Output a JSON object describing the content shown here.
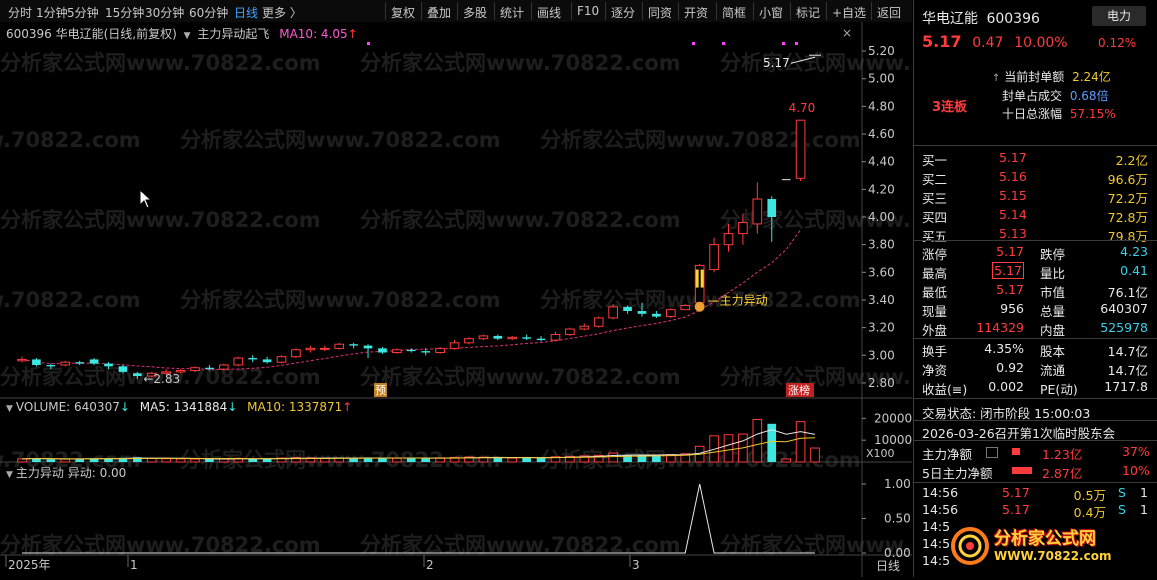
{
  "toolbar": {
    "periods": [
      "分时",
      "1分钟",
      "5分钟",
      "15分钟",
      "30分钟",
      "60分钟",
      "日线",
      "更多 〉"
    ],
    "active_period": "日线",
    "tools": [
      "复权",
      "叠加",
      "多股",
      "统计",
      "画线",
      "F10",
      "逐分",
      "同资",
      "开资",
      "简框",
      "小窗",
      "标记",
      "+自选",
      "返回"
    ]
  },
  "chart": {
    "header_code_name": "600396 华电辽能(日线,前复权)",
    "indicator_name": "主力异动起飞",
    "ma10_label": "MA10: 4.05",
    "ma10_arrow": "↑",
    "watermark": "分析家公式网www.70822.com",
    "y_ticks": [
      "5.20",
      "5.00",
      "4.80",
      "4.60",
      "4.40",
      "4.20",
      "4.00",
      "3.80",
      "3.60",
      "3.40",
      "3.20",
      "3.00",
      "2.80"
    ],
    "high_label": "4.70",
    "low_label": "←2.83",
    "last_label": "5.17",
    "signal_label": "主力异动",
    "tag_pre": "预",
    "tag_zhangbang": "涨榜"
  },
  "volume": {
    "label": "VOLUME: 640307",
    "vol_arrow": "↓",
    "ma5": "MA5: 1341884",
    "ma5_arrow": "↓",
    "ma10": "MA10: 1337871",
    "ma10_arrow": "↑",
    "y_ticks": [
      "20000",
      "10000"
    ],
    "unit": "X100"
  },
  "anomaly": {
    "label": "主力异动  异动: 0.00",
    "y_ticks": [
      "1.00",
      "0.50",
      "0.00"
    ]
  },
  "x_axis": {
    "labels": [
      "2025年",
      "1",
      "2",
      "3"
    ],
    "period": "日线"
  },
  "panel": {
    "stock_name": "华电辽能",
    "stock_code": "600396",
    "sector": "电力",
    "price": "5.17",
    "change": "0.47",
    "change_pct": "10.00%",
    "sector_pct": "0.12%",
    "streak": "3连板",
    "seal_amount_label": "当前封单额",
    "seal_amount": "2.24亿",
    "seal_ratio_label": "封单占成交",
    "seal_ratio": "0.68倍",
    "ten_day_label": "十日总涨幅",
    "ten_day": "57.15%",
    "bids": [
      {
        "label": "买一",
        "price": "5.17",
        "vol": "2.2亿"
      },
      {
        "label": "买二",
        "price": "5.16",
        "vol": "96.6万"
      },
      {
        "label": "买三",
        "price": "5.15",
        "vol": "72.2万"
      },
      {
        "label": "买四",
        "price": "5.14",
        "vol": "72.8万"
      },
      {
        "label": "买五",
        "price": "5.13",
        "vol": "79.8万"
      }
    ],
    "stats": [
      {
        "l1": "涨停",
        "v1": "5.17",
        "l2": "跌停",
        "v2": "4.23"
      },
      {
        "l1": "最高",
        "v1": "5.17",
        "l2": "量比",
        "v2": "0.41"
      },
      {
        "l1": "最低",
        "v1": "5.17",
        "l2": "市值",
        "v2": "76.1亿"
      },
      {
        "l1": "现量",
        "v1": "956",
        "l2": "总量",
        "v2": "640307"
      },
      {
        "l1": "外盘",
        "v1": "114329",
        "l2": "内盘",
        "v2": "525978"
      }
    ],
    "fin": [
      {
        "l1": "换手",
        "v1": "4.35%",
        "l2": "股本",
        "v2": "14.7亿"
      },
      {
        "l1": "净资",
        "v1": "0.92",
        "l2": "流通",
        "v2": "14.7亿"
      },
      {
        "l1": "收益(≡)",
        "v1": "0.002",
        "l2": "PE(动)",
        "v2": "1717.8"
      }
    ],
    "trade_status": "交易状态: 闭市阶段 15:00:03",
    "notice": "2026-03-26召开第1次临时股东会",
    "flow1_label": "主力净额",
    "flow1_value": "1.23亿",
    "flow1_pct": "37%",
    "flow2_label": "5日主力净额",
    "flow2_value": "2.87亿",
    "flow2_pct": "10%",
    "ticks": [
      {
        "time": "14:56",
        "price": "5.17",
        "vol": "0.5万",
        "side": "S",
        "n": "1"
      },
      {
        "time": "14:56",
        "price": "5.17",
        "vol": "0.4万",
        "side": "S",
        "n": "1"
      },
      {
        "time": "14:5",
        "price": "",
        "vol": "",
        "side": "",
        "n": ""
      },
      {
        "time": "14:5",
        "price": "",
        "vol": "",
        "side": "",
        "n": ""
      },
      {
        "time": "14:5",
        "price": "",
        "vol": "",
        "side": "",
        "n": ""
      }
    ],
    "logo_text": "分析家公式网",
    "logo_url": "WWW.70822.com"
  },
  "colors": {
    "up": "#ff3b3b",
    "down": "#3ee6e0",
    "ma": "#e8e8e8",
    "ma10": "#f0c830"
  },
  "chart_data": {
    "type": "candlestick",
    "ylim": [
      2.72,
      5.28
    ],
    "candles": [
      [
        2.96,
        2.97,
        2.95,
        2.99
      ],
      [
        2.97,
        2.93,
        2.92,
        2.98
      ],
      [
        2.93,
        2.92,
        2.9,
        2.94
      ],
      [
        2.93,
        2.95,
        2.92,
        2.96
      ],
      [
        2.95,
        2.94,
        2.93,
        2.96
      ],
      [
        2.97,
        2.94,
        2.93,
        2.98
      ],
      [
        2.94,
        2.92,
        2.9,
        2.95
      ],
      [
        2.92,
        2.88,
        2.87,
        2.93
      ],
      [
        2.87,
        2.85,
        2.83,
        2.88
      ],
      [
        2.85,
        2.87,
        2.84,
        2.88
      ],
      [
        2.87,
        2.88,
        2.86,
        2.9
      ],
      [
        2.88,
        2.89,
        2.87,
        2.9
      ],
      [
        2.89,
        2.91,
        2.88,
        2.92
      ],
      [
        2.91,
        2.9,
        2.89,
        2.93
      ],
      [
        2.9,
        2.93,
        2.89,
        2.94
      ],
      [
        2.93,
        2.98,
        2.92,
        2.99
      ],
      [
        2.98,
        2.97,
        2.95,
        3.0
      ],
      [
        2.97,
        2.95,
        2.94,
        2.99
      ],
      [
        2.95,
        2.99,
        2.94,
        3.0
      ],
      [
        2.99,
        3.04,
        2.98,
        3.05
      ],
      [
        3.04,
        3.05,
        3.02,
        3.07
      ],
      [
        3.05,
        3.05,
        3.03,
        3.07
      ],
      [
        3.05,
        3.08,
        3.04,
        3.09
      ],
      [
        3.08,
        3.07,
        3.05,
        3.09
      ],
      [
        3.07,
        3.05,
        2.98,
        3.08
      ],
      [
        3.05,
        3.02,
        3.01,
        3.06
      ],
      [
        3.02,
        3.04,
        3.01,
        3.05
      ],
      [
        3.04,
        3.03,
        3.02,
        3.05
      ],
      [
        3.03,
        3.02,
        3.0,
        3.05
      ],
      [
        3.02,
        3.05,
        3.01,
        3.06
      ],
      [
        3.05,
        3.09,
        3.04,
        3.11
      ],
      [
        3.09,
        3.12,
        3.08,
        3.13
      ],
      [
        3.12,
        3.14,
        3.11,
        3.15
      ],
      [
        3.14,
        3.12,
        3.11,
        3.15
      ],
      [
        3.12,
        3.13,
        3.11,
        3.14
      ],
      [
        3.13,
        3.12,
        3.11,
        3.15
      ],
      [
        3.12,
        3.11,
        3.1,
        3.14
      ],
      [
        3.11,
        3.15,
        3.1,
        3.17
      ],
      [
        3.15,
        3.19,
        3.14,
        3.2
      ],
      [
        3.19,
        3.21,
        3.18,
        3.23
      ],
      [
        3.21,
        3.27,
        3.2,
        3.28
      ],
      [
        3.27,
        3.35,
        3.26,
        3.37
      ],
      [
        3.35,
        3.32,
        3.3,
        3.36
      ],
      [
        3.32,
        3.3,
        3.28,
        3.38
      ],
      [
        3.3,
        3.28,
        3.27,
        3.32
      ],
      [
        3.28,
        3.33,
        3.27,
        3.34
      ],
      [
        3.33,
        3.36,
        3.33,
        3.37
      ],
      [
        3.38,
        3.65,
        3.36,
        3.66
      ],
      [
        3.62,
        3.8,
        3.6,
        3.85
      ],
      [
        3.8,
        3.88,
        3.75,
        3.95
      ],
      [
        3.88,
        3.96,
        3.8,
        4.02
      ],
      [
        3.95,
        4.13,
        3.88,
        4.25
      ],
      [
        4.13,
        4.0,
        3.82,
        4.15
      ],
      [
        4.27,
        4.27,
        4.27,
        4.27
      ],
      [
        4.28,
        4.7,
        4.26,
        4.7
      ],
      [
        5.17,
        5.17,
        5.17,
        5.17
      ]
    ],
    "volumes": [
      1400,
      1800,
      1200,
      1300,
      1500,
      1600,
      1700,
      1900,
      2200,
      1600,
      1500,
      1400,
      1300,
      1300,
      1400,
      1700,
      1500,
      1600,
      1800,
      2000,
      1900,
      1700,
      1800,
      1600,
      2100,
      2000,
      1700,
      1700,
      1600,
      1900,
      2100,
      2300,
      2200,
      2000,
      1800,
      1900,
      2100,
      2400,
      2600,
      2800,
      3000,
      4100,
      3200,
      3000,
      2800,
      3400,
      3800,
      7200,
      12000,
      12500,
      12800,
      19500,
      17500,
      1400,
      18500,
      6400
    ],
    "anomaly": {
      "index": 47,
      "value": 1.0
    }
  }
}
